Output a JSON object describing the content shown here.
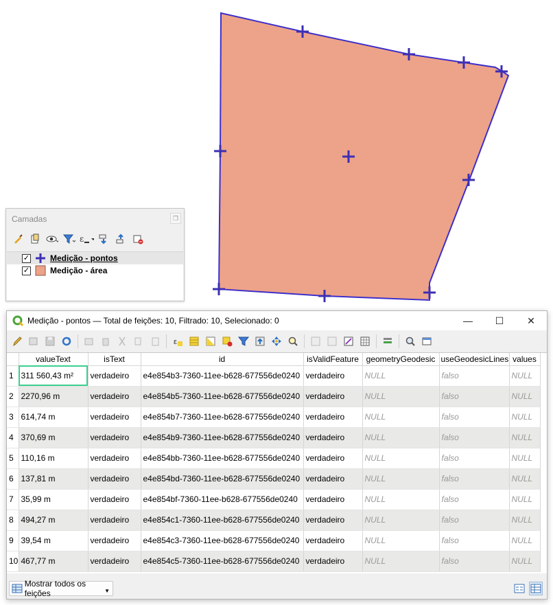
{
  "map": {
    "polygon_fill": "#eda389",
    "polygon_stroke": "#3d2fc9",
    "point_color": "#3d2fb4"
  },
  "layers_panel": {
    "title": "Camadas",
    "layers": [
      {
        "label": "Medição - pontos",
        "checked": true,
        "active": true,
        "symbol": "cross"
      },
      {
        "label": "Medição - área",
        "checked": true,
        "active": false,
        "symbol": "fill",
        "color": "#eda389"
      }
    ]
  },
  "attribute_window": {
    "title": "Medição - pontos — Total de feições: 10, Filtrado: 10, Selecionado: 0",
    "columns": [
      "valueText",
      "isText",
      "id",
      "isValidFeature",
      "geometryGeodesic",
      "useGeodesicLines",
      "values"
    ],
    "rows": [
      [
        "311 560,43 m²",
        "verdadeiro",
        "e4e854b3-7360-11ee-b628-677556de0240",
        "verdadeiro",
        "NULL",
        "falso",
        "NULL"
      ],
      [
        "2270,96 m",
        "verdadeiro",
        "e4e854b5-7360-11ee-b628-677556de0240",
        "verdadeiro",
        "NULL",
        "falso",
        "NULL"
      ],
      [
        "614,74 m",
        "verdadeiro",
        "e4e854b7-7360-11ee-b628-677556de0240",
        "verdadeiro",
        "NULL",
        "falso",
        "NULL"
      ],
      [
        "370,69 m",
        "verdadeiro",
        "e4e854b9-7360-11ee-b628-677556de0240",
        "verdadeiro",
        "NULL",
        "falso",
        "NULL"
      ],
      [
        "110,16 m",
        "verdadeiro",
        "e4e854bb-7360-11ee-b628-677556de0240",
        "verdadeiro",
        "NULL",
        "falso",
        "NULL"
      ],
      [
        "137,81 m",
        "verdadeiro",
        "e4e854bd-7360-11ee-b628-677556de0240",
        "verdadeiro",
        "NULL",
        "falso",
        "NULL"
      ],
      [
        "35,99 m",
        "verdadeiro",
        "e4e854bf-7360-11ee-b628-677556de0240",
        "verdadeiro",
        "NULL",
        "falso",
        "NULL"
      ],
      [
        "494,27 m",
        "verdadeiro",
        "e4e854c1-7360-11ee-b628-677556de0240",
        "verdadeiro",
        "NULL",
        "falso",
        "NULL"
      ],
      [
        "39,54 m",
        "verdadeiro",
        "e4e854c3-7360-11ee-b628-677556de0240",
        "verdadeiro",
        "NULL",
        "falso",
        "NULL"
      ],
      [
        "467,77 m",
        "verdadeiro",
        "e4e854c5-7360-11ee-b628-677556de0240",
        "verdadeiro",
        "NULL",
        "falso",
        "NULL"
      ]
    ],
    "row_numbers": [
      "1",
      "2",
      "3",
      "4",
      "5",
      "6",
      "7",
      "8",
      "9",
      "10"
    ],
    "show_features_label": "Mostrar todos os feições",
    "selected_cell_color": "#3ccf8e"
  }
}
